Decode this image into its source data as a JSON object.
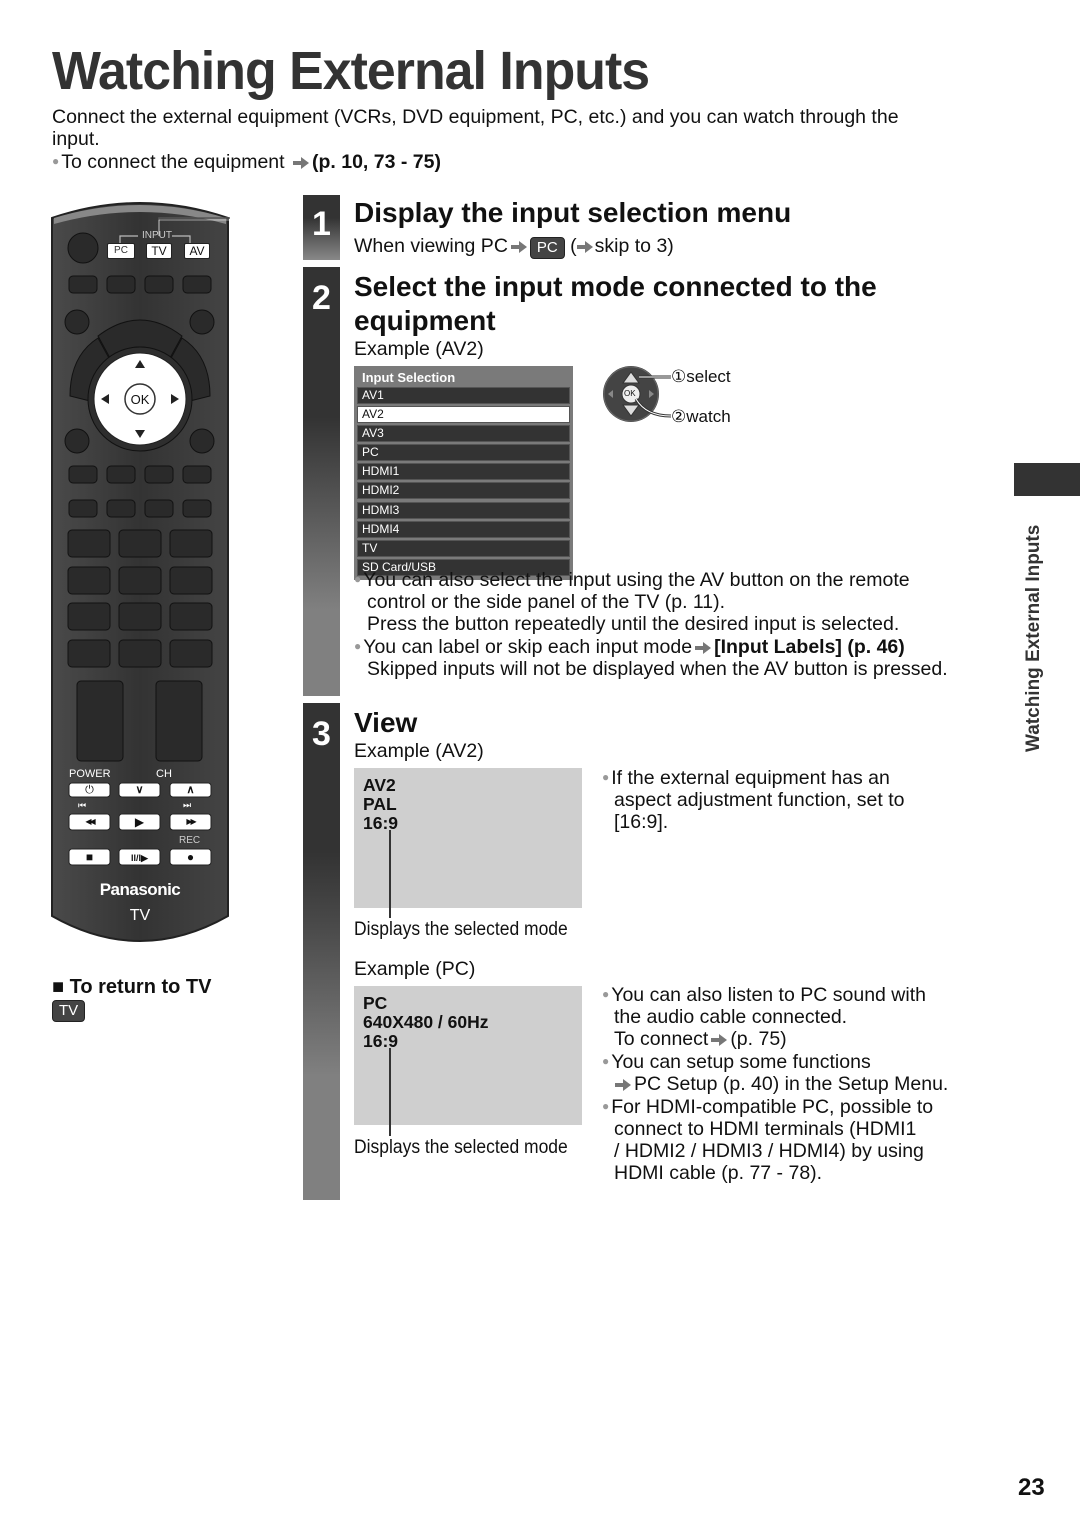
{
  "header": {
    "title": "Watching External Inputs",
    "intro": "Connect the external equipment (VCRs, DVD equipment, PC, etc.) and you can watch through the input.",
    "intro_line1": "Connect the external equipment (VCRs, DVD equipment, PC, etc.) and you can watch through the",
    "intro_line2": "input.",
    "connect_text": "To connect the equipment",
    "connect_ref": "(p. 10, 73 - 75)"
  },
  "remote": {
    "input_label": "INPUT",
    "buttons_top": [
      "PC",
      "TV",
      "AV"
    ],
    "ok_label": "OK",
    "power_label": "POWER",
    "ch_label": "CH",
    "rec_label": "REC",
    "brand": "Panasonic",
    "model": "TV",
    "icons": {
      "power": "⏻",
      "ch_down": "∨",
      "ch_up": "∧",
      "skip_back": "⏮",
      "skip_fwd": "⏭",
      "rewind": "◀◀",
      "play": "▶",
      "ffwd": "▶▶",
      "stop": "■",
      "pause": "II/I▶",
      "rec": "●"
    }
  },
  "return_to_tv": {
    "heading": "■ To return to TV",
    "key": "TV"
  },
  "steps": [
    {
      "number": "1",
      "title": "Display the input selection menu",
      "sub_prefix": "When viewing PC",
      "sub_key": "PC",
      "sub_suffix_open": "(",
      "sub_suffix": "skip to 3)"
    },
    {
      "number": "2",
      "title_line1": "Select the input mode connected to the",
      "title_line2": "equipment",
      "example": "Example (AV2)",
      "menu": {
        "title": "Input Selection",
        "items": [
          "AV1",
          "AV2",
          "AV3",
          "PC",
          "HDMI1",
          "HDMI2",
          "HDMI3",
          "HDMI4",
          "TV",
          "SD Card/USB"
        ],
        "selected": "AV2"
      },
      "nav_hint": {
        "select": "①select",
        "watch": "②watch",
        "ok_label": "OK"
      },
      "notes": [
        {
          "line1": "You can also select the input using the AV button on the remote",
          "line2": "control or the side panel of the TV (p. 11).",
          "line3": "Press the button repeatedly until the desired input is selected."
        },
        {
          "line1_prefix": "You can label or skip each input mode",
          "line1_ref": "[Input Labels] (p. 46)",
          "line2": "Skipped inputs will not be displayed when the AV button is pressed."
        }
      ]
    },
    {
      "number": "3",
      "title": "View",
      "examples": [
        {
          "label": "Example (AV2)",
          "screen_lines": [
            "AV2",
            "PAL",
            "16:9"
          ],
          "caption": "Displays the selected mode",
          "notes": [
            "If the external equipment has an",
            "aspect adjustment function, set to",
            "[16:9]."
          ]
        },
        {
          "label": "Example (PC)",
          "screen_lines": [
            "PC",
            "640X480 / 60Hz",
            "16:9"
          ],
          "caption": "Displays the selected mode",
          "notes": {
            "n1_l1": "You can also listen to PC sound with",
            "n1_l2": "the audio cable connected.",
            "n1_l3_prefix": "To connect",
            "n1_l3_ref": "(p. 75)",
            "n2_l1": "You can setup some functions",
            "n2_l2": "PC Setup (p. 40) in the Setup Menu.",
            "n3_l1": "For HDMI-compatible PC, possible to",
            "n3_l2": "connect to HDMI terminals (HDMI1",
            "n3_l3": "/ HDMI2 / HDMI3 / HDMI4) by using",
            "n3_l4": "HDMI cable (p. 77 - 78)."
          }
        }
      ]
    }
  ],
  "side_label": "Watching External Inputs",
  "page_number": "23",
  "colors": {
    "dark_gray": "#333333",
    "mid_gray": "#7a7a7a",
    "screen_gray": "#cfcfcf",
    "bullet": "#999999"
  }
}
